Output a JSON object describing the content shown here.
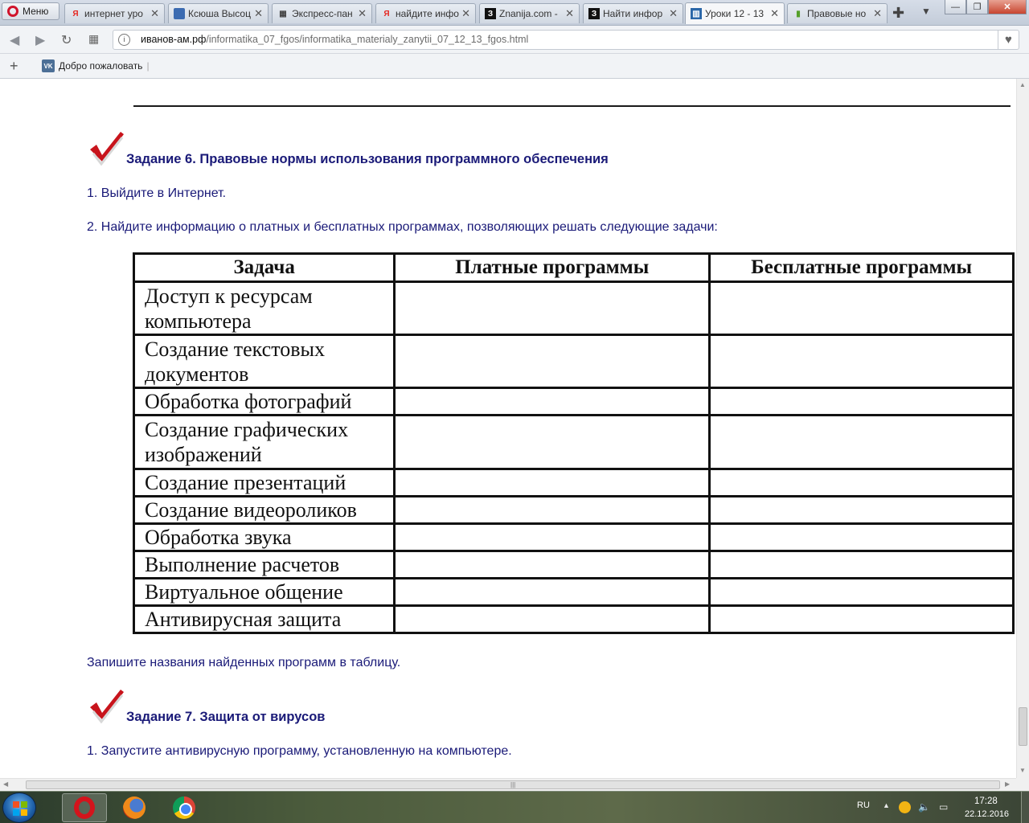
{
  "browser": {
    "menu_label": "Меню",
    "tabs": [
      {
        "title": "интернет уро",
        "favicon": "Я",
        "favicon_color": "#e52620"
      },
      {
        "title": "Ксюша Высоц",
        "favicon": "",
        "favicon_color": "#3b6bb1"
      },
      {
        "title": "Экспресс-пан",
        "favicon": "▦",
        "favicon_color": "#444444"
      },
      {
        "title": "найдите инфо",
        "favicon": "Я",
        "favicon_color": "#e52620"
      },
      {
        "title": "Znanija.com -",
        "favicon": "З",
        "favicon_color": "#111111"
      },
      {
        "title": "Найти инфор",
        "favicon": "З",
        "favicon_color": "#111111"
      },
      {
        "title": "Уроки 12 - 13",
        "favicon": "▥",
        "favicon_color": "#2b67a8"
      },
      {
        "title": "Правовые но",
        "favicon": "▮",
        "favicon_color": "#55a02a"
      }
    ],
    "url_host": "иванов-ам.рф",
    "url_path": "/informatika_07_fgos/informatika_materialy_zanytii_07_12_13_fgos.html",
    "bookmark": "Добро пожаловать"
  },
  "page": {
    "task6_title": "Задание 6. Правовые нормы использования программного обеспечения",
    "task6_step1": "1. Выйдите в Интернет.",
    "task6_step2": "2. Найдите информацию о платных и бесплатных программах, позволяющих решать следующие задачи:",
    "table": {
      "headers": [
        "Задача",
        "Платные программы",
        "Бесплатные программы"
      ],
      "rows": [
        "Доступ к ресурсам компьютера",
        "Создание текстовых документов",
        "Обработка фотографий",
        "Создание графических изображений",
        "Создание презентаций",
        "Создание видеороликов",
        "Обработка звука",
        "Выполнение расчетов",
        "Виртуальное общение",
        "Антивирусная защита"
      ]
    },
    "after_table": "Запишите названия найденных программ в таблицу.",
    "task7_title": "Задание 7. Защита от вирусов",
    "task7_step1": "1. Запустите антивирусную программу, установленную на компьютере."
  },
  "taskbar": {
    "lang": "RU",
    "time": "17:28",
    "date": "22.12.2016",
    "apps": [
      "opera-icon",
      "firefox-icon",
      "chrome-icon"
    ]
  },
  "colors": {
    "text_accent": "#1a1a78",
    "check_red": "#c8141c"
  }
}
